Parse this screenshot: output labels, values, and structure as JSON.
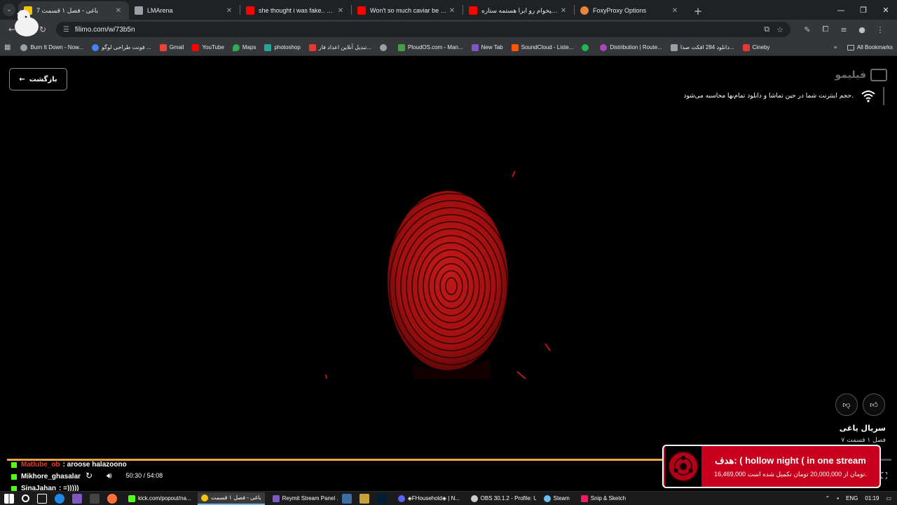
{
  "browser": {
    "tabs": [
      {
        "title": "باغی - فصل ۱ قسمت 7",
        "color": "#f4c20d",
        "active": true
      },
      {
        "title": "LMArena",
        "color": "#9aa0a6",
        "active": false
      },
      {
        "title": "she thought i was fake.. #omeg",
        "color": "#ff0000",
        "active": false
      },
      {
        "title": "Won't so much caviar be too sa",
        "color": "#ff0000",
        "active": false
      },
      {
        "title": "گفتی میخوام رو ابرا هستمه ستاره",
        "color": "#ff0000",
        "active": false
      },
      {
        "title": "FoxyProxy Options",
        "color": "#e8843c",
        "active": false
      }
    ],
    "url": "filimo.com/w/73b5n",
    "bookmarks": [
      {
        "label": "Burn It Down - Now...",
        "color": "#9aa0a6"
      },
      {
        "label": "فونت طراحی لوگو ...",
        "color": "#4285f4"
      },
      {
        "label": "Gmail",
        "color": "#ea4335"
      },
      {
        "label": "YouTube",
        "color": "#ff0000"
      },
      {
        "label": "Maps",
        "color": "#34a853"
      },
      {
        "label": "photoshop",
        "color": "#26a69a"
      },
      {
        "label": "تبدیل آنلاین اعداد فار...",
        "color": "#e53935"
      },
      {
        "label": "",
        "color": "#9aa0a6"
      },
      {
        "label": "PloudOS.com - Man...",
        "color": "#43a047"
      },
      {
        "label": "New Tab",
        "color": "#7e57c2"
      },
      {
        "label": "SoundCloud - Liste...",
        "color": "#ff5500"
      },
      {
        "label": "",
        "color": "#1db954"
      },
      {
        "label": "Distribution | Route...",
        "color": "#ab47bc"
      },
      {
        "label": "دانلود 284 افکت صدا...",
        "color": "#9aa0a6"
      },
      {
        "label": "Cineby",
        "color": "#e53935"
      }
    ],
    "all_bookmarks": "All Bookmarks"
  },
  "player": {
    "back_label": "بازگشت",
    "logo": "فیلیمو",
    "net_notice": "حجم اینترنت شما در حین تماشا و دانلود تمام‌بها محاسبه می‌شود.",
    "series_title": "سریال یاغی",
    "series_sub": "فصل ۱ قسمت ۷",
    "time": "50:30 / 54:08",
    "progress": 0.933
  },
  "chat": [
    {
      "user": "Matlube_ob",
      "text": ": aroose halazoono",
      "user_color": "#e53935"
    },
    {
      "user": "Mikhore_ghasalar",
      "text": "",
      "user_color": "#ffffff"
    },
    {
      "user": "SinaJahan",
      "text": ": =)))))",
      "user_color": "#ffffff"
    }
  ],
  "goal": {
    "title": "هدف: ( hollow night ( in one stream",
    "progress": "16,469,000 تومان از 20,000,000 تومان تکمیل شده است."
  },
  "taskbar": {
    "items": [
      {
        "label": "kick.com/popout/na...",
        "color": "#53fc18",
        "active": false
      },
      {
        "label": "باغی - فصل ۱ قسمت",
        "color": "#f4c20d",
        "active": true
      },
      {
        "label": "Reymit Stream Panel ...",
        "color": "#7e57c2",
        "active": false
      },
      {
        "label": "◈FHousehold◈ | N...",
        "color": "#5865f2",
        "active": false
      },
      {
        "label": "OBS 30.1.2 - Profile: U...",
        "color": "#cccccc",
        "active": false
      },
      {
        "label": "Steam",
        "color": "#1b2838",
        "active": false
      },
      {
        "label": "Snip & Sketch",
        "color": "#e91e63",
        "active": false
      }
    ],
    "lang": "ENG",
    "clock": "01:19"
  }
}
